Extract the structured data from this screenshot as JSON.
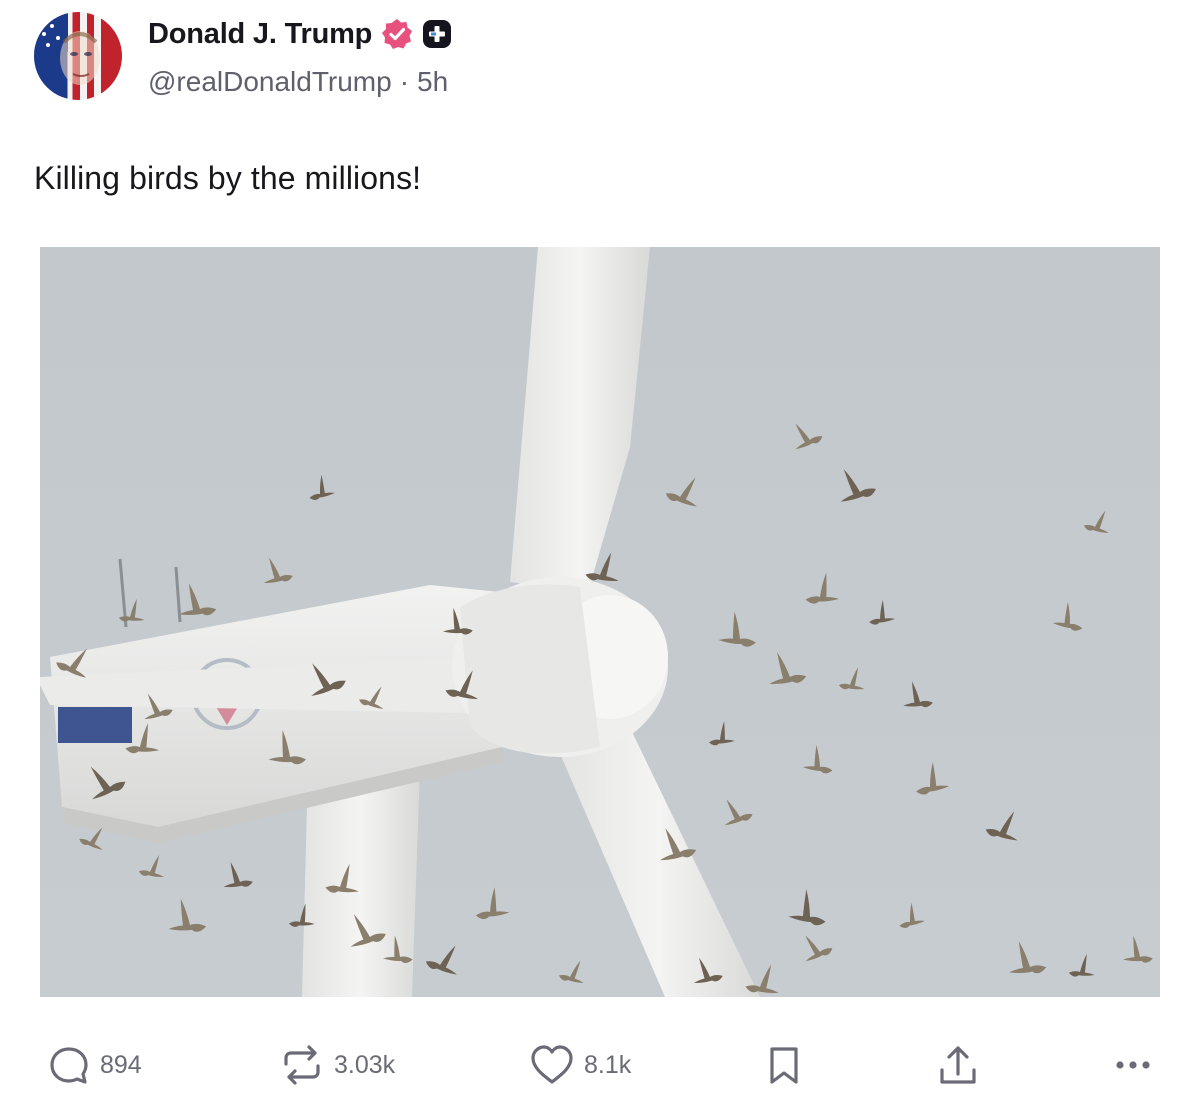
{
  "post": {
    "author": {
      "display_name": "Donald J. Trump",
      "handle": "@realDonaldTrump",
      "separator": "·",
      "time_ago": "5h",
      "verified_color": "#e8507d",
      "avatar_icon": "flag-portrait-avatar"
    },
    "text": "Killing birds by the millions!",
    "media": {
      "description_icon": "wind-turbine-photo"
    }
  },
  "actions": {
    "replies": {
      "icon": "reply-icon",
      "count": "894"
    },
    "reposts": {
      "icon": "repost-icon",
      "count": "3.03k"
    },
    "likes": {
      "icon": "heart-icon",
      "count": "8.1k"
    },
    "bookmark": {
      "icon": "bookmark-icon"
    },
    "share": {
      "icon": "share-icon"
    },
    "more": {
      "icon": "more-icon"
    }
  },
  "colors": {
    "icon_gray": "#6b6b78",
    "sky": "#c3c9cd",
    "turbine": "#ecedec"
  }
}
